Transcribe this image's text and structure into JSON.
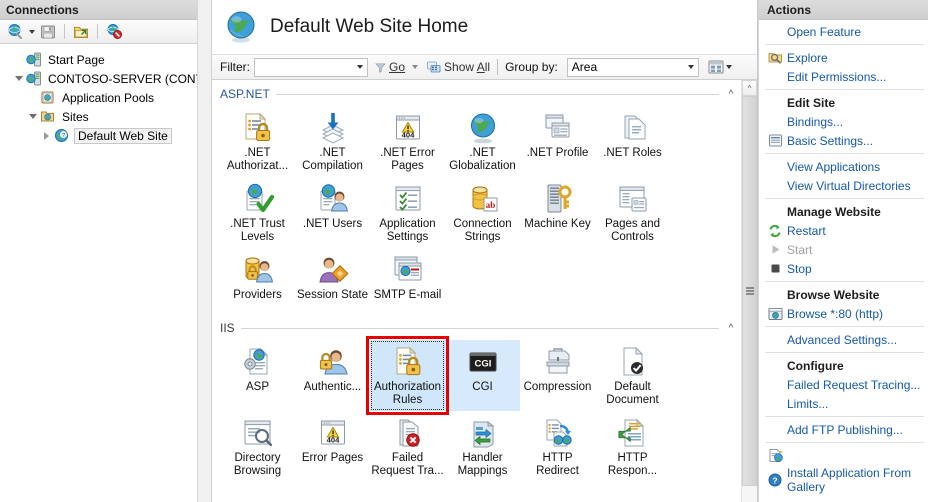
{
  "connections": {
    "header": "Connections",
    "toolbar": [
      {
        "name": "connect-to-icon",
        "label": "Connect to"
      },
      {
        "name": "save-icon",
        "label": "Save Connections"
      },
      {
        "name": "connect-to-site-icon",
        "label": "Connect to a Site"
      },
      {
        "name": "disconnect-icon",
        "label": "Disconnect"
      }
    ],
    "tree": [
      {
        "label": "Start Page",
        "level": 1,
        "expander": "none",
        "icon": "start-page-icon",
        "selected": false
      },
      {
        "label": "CONTOSO-SERVER (CONTOS",
        "level": 1,
        "expander": "down",
        "icon": "server-icon",
        "selected": false
      },
      {
        "label": "Application Pools",
        "level": 2,
        "expander": "none",
        "icon": "application-pools-icon",
        "selected": false
      },
      {
        "label": "Sites",
        "level": 2,
        "expander": "down",
        "icon": "sites-folder-icon",
        "selected": false
      },
      {
        "label": "Default Web Site",
        "level": 3,
        "expander": "right",
        "icon": "website-icon",
        "selected": true
      }
    ]
  },
  "main": {
    "page_title": "Default Web Site Home",
    "page_icon": "globe-icon",
    "filter_bar": {
      "filter_label": "Filter:",
      "filter_value": "",
      "go_label": "Go",
      "show_all_label": "Show All",
      "group_by_label": "Group by:",
      "group_by_value": "Area"
    },
    "groups": [
      {
        "name": "ASP.NET",
        "collapse_chevron": "^",
        "tiles": [
          {
            "label": ".NET Authorizat...",
            "icon": "net-authorization-icon"
          },
          {
            "label": ".NET Compilation",
            "icon": "net-compilation-icon"
          },
          {
            "label": ".NET Error Pages",
            "icon": "net-error-pages-icon"
          },
          {
            "label": ".NET Globalization",
            "icon": "net-globalization-icon"
          },
          {
            "label": ".NET Profile",
            "icon": "net-profile-icon"
          },
          {
            "label": ".NET Roles",
            "icon": "net-roles-icon"
          },
          {
            "label": ".NET Trust Levels",
            "icon": "net-trust-levels-icon"
          },
          {
            "label": ".NET Users",
            "icon": "net-users-icon"
          },
          {
            "label": "Application Settings",
            "icon": "application-settings-icon"
          },
          {
            "label": "Connection Strings",
            "icon": "connection-strings-icon"
          },
          {
            "label": "Machine Key",
            "icon": "machine-key-icon"
          },
          {
            "label": "Pages and Controls",
            "icon": "pages-and-controls-icon"
          },
          {
            "label": "Providers",
            "icon": "providers-icon"
          },
          {
            "label": "Session State",
            "icon": "session-state-icon"
          },
          {
            "label": "SMTP E-mail",
            "icon": "smtp-email-icon"
          }
        ]
      },
      {
        "name": "IIS",
        "collapse_chevron": "^",
        "tiles": [
          {
            "label": "ASP",
            "icon": "asp-icon"
          },
          {
            "label": "Authentic...",
            "icon": "authentication-icon"
          },
          {
            "label": "Authorization Rules",
            "icon": "authorization-rules-icon",
            "state": "focused-selected",
            "highlighted": true
          },
          {
            "label": "CGI",
            "icon": "cgi-icon",
            "state": "selected"
          },
          {
            "label": "Compression",
            "icon": "compression-icon"
          },
          {
            "label": "Default Document",
            "icon": "default-document-icon"
          },
          {
            "label": "Directory Browsing",
            "icon": "directory-browsing-icon"
          },
          {
            "label": "Error Pages",
            "icon": "error-pages-icon"
          },
          {
            "label": "Failed Request Tra...",
            "icon": "failed-request-tracing-icon"
          },
          {
            "label": "Handler Mappings",
            "icon": "handler-mappings-icon"
          },
          {
            "label": "HTTP Redirect",
            "icon": "http-redirect-icon"
          },
          {
            "label": "HTTP Respon...",
            "icon": "http-response-headers-icon"
          }
        ]
      }
    ]
  },
  "actions": {
    "header": "Actions",
    "items": [
      {
        "type": "link",
        "label": "Open Feature",
        "icon": null
      },
      {
        "type": "divider"
      },
      {
        "type": "link",
        "label": "Explore",
        "icon": "explore-icon"
      },
      {
        "type": "link",
        "label": "Edit Permissions...",
        "icon": null
      },
      {
        "type": "divider"
      },
      {
        "type": "title",
        "label": "Edit Site"
      },
      {
        "type": "link",
        "label": "Bindings...",
        "icon": null
      },
      {
        "type": "link",
        "label": "Basic Settings...",
        "icon": "basic-settings-icon"
      },
      {
        "type": "divider"
      },
      {
        "type": "link",
        "label": "View Applications",
        "icon": null
      },
      {
        "type": "link",
        "label": "View Virtual Directories",
        "icon": null
      },
      {
        "type": "divider"
      },
      {
        "type": "title",
        "label": "Manage Website"
      },
      {
        "type": "link",
        "label": "Restart",
        "icon": "restart-icon"
      },
      {
        "type": "link",
        "label": "Start",
        "icon": "start-icon",
        "disabled": true
      },
      {
        "type": "link",
        "label": "Stop",
        "icon": "stop-icon"
      },
      {
        "type": "divider"
      },
      {
        "type": "title",
        "label": "Browse Website"
      },
      {
        "type": "link",
        "label": "Browse *:80 (http)",
        "icon": "browse-icon"
      },
      {
        "type": "divider"
      },
      {
        "type": "link",
        "label": "Advanced Settings...",
        "icon": null
      },
      {
        "type": "divider"
      },
      {
        "type": "title",
        "label": "Configure"
      },
      {
        "type": "link",
        "label": "Failed Request Tracing...",
        "icon": null
      },
      {
        "type": "link",
        "label": "Limits...",
        "icon": null
      },
      {
        "type": "divider"
      },
      {
        "type": "link",
        "label": "Add FTP Publishing...",
        "icon": null
      },
      {
        "type": "divider"
      },
      {
        "type": "link",
        "label": "Install Application From Gallery",
        "icon": "install-app-icon"
      },
      {
        "type": "link",
        "label": "Help",
        "icon": "help-icon"
      }
    ]
  },
  "colors": {
    "link": "#1559a8",
    "group_title": "#2b5797",
    "highlight_box": "#e60000",
    "selection": "#cfe6fb",
    "header_bg": "#d4d4d4"
  }
}
